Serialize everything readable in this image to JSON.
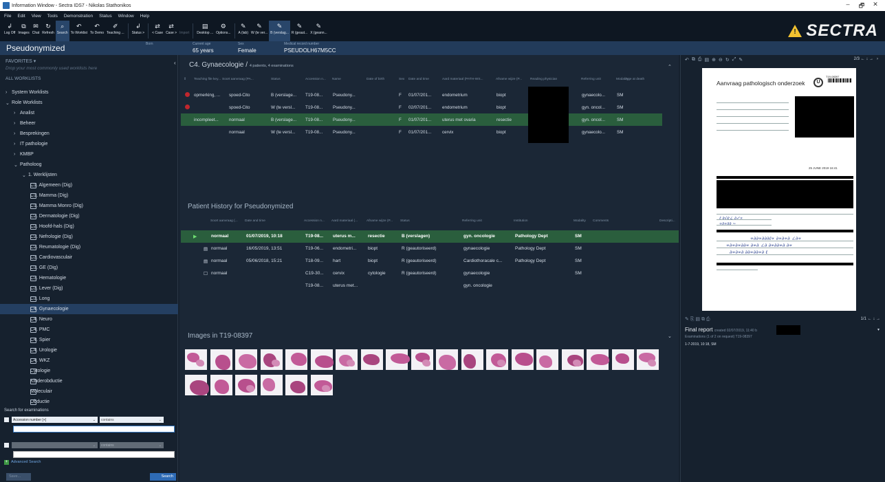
{
  "window": {
    "title": "Information Window - Sectra IDS7 - Nikolas Stathonikos",
    "controls": [
      "–",
      "🗗",
      "✕"
    ]
  },
  "menu": [
    "File",
    "Edit",
    "View",
    "Tools",
    "Demonstration",
    "Status",
    "Window",
    "Help"
  ],
  "toolbar": [
    {
      "label": "Log Off",
      "icon": "↲"
    },
    {
      "label": "Images",
      "icon": "⧉"
    },
    {
      "label": "Chat",
      "icon": "✉"
    },
    {
      "label": "Refresh",
      "icon": "↻"
    },
    {
      "label": "Search",
      "icon": "⌕",
      "active": true
    },
    {
      "label": "To Worklist",
      "icon": "↶"
    },
    {
      "label": "To Demo",
      "icon": "↶"
    },
    {
      "label": "Teaching ...",
      "icon": "✐"
    },
    {
      "label": "Status >",
      "icon": "↲"
    },
    {
      "label": "< Case",
      "icon": "⇄"
    },
    {
      "label": "Case >",
      "icon": "⇄"
    },
    {
      "label": "Import",
      "icon": "",
      "disabled": true
    },
    {
      "label": "Desktop ...",
      "icon": "▤"
    },
    {
      "label": "Options...",
      "icon": "⚙"
    },
    {
      "label": "A (lab)",
      "icon": "✎"
    },
    {
      "label": "W (te ver...",
      "icon": "✎"
    },
    {
      "label": "B (verslag...",
      "icon": "✎",
      "active": true
    },
    {
      "label": "R (geaut...",
      "icon": "✎"
    },
    {
      "label": "X (geann...",
      "icon": "✎"
    }
  ],
  "brand": {
    "name": "SECTRA",
    "warning_color": "#f2c230"
  },
  "patient": {
    "name": "Pseudonymized",
    "fields": [
      {
        "label": "Born",
        "value": ""
      },
      {
        "label": "Current age",
        "value": "65 years"
      },
      {
        "label": "Sex",
        "value": "Female"
      },
      {
        "label": "Medical record number",
        "value": "PSEUDOLH67M5CC"
      }
    ]
  },
  "sidebar": {
    "favorites": "FAVORITES ▾",
    "drop_hint": "Drop your most commonly used worklists here",
    "all_worklists": "ALL WORKLISTS",
    "items": [
      {
        "label": "System Worklists",
        "level": 0,
        "arrow": "›"
      },
      {
        "label": "Role Worklists",
        "level": 0,
        "arrow": "⌄"
      },
      {
        "label": "Analist",
        "level": 1,
        "arrow": "›"
      },
      {
        "label": "Beheer",
        "level": 1,
        "arrow": "›"
      },
      {
        "label": "Besprekingen",
        "level": 1,
        "arrow": "›"
      },
      {
        "label": "IT pathologie",
        "level": 1,
        "arrow": "›"
      },
      {
        "label": "KMBP",
        "level": 1,
        "arrow": "›"
      },
      {
        "label": "Patholoog",
        "level": 1,
        "arrow": "⌄"
      },
      {
        "label": "1. Werklijsten",
        "level": 2,
        "arrow": "⌄"
      },
      {
        "label": "C1. Algemeen (Dig)",
        "level": 3,
        "doc": true
      },
      {
        "label": "C1. Mamma (Dig)",
        "level": 3,
        "doc": true
      },
      {
        "label": "C1. Mamma Monro (Dig)",
        "level": 3,
        "doc": true
      },
      {
        "label": "C2. Dermatologie (Dig)",
        "level": 3,
        "doc": true
      },
      {
        "label": "C2. Hoofd-hals (Dig)",
        "level": 3,
        "doc": true
      },
      {
        "label": "C2. Nefrologie (Dig)",
        "level": 3,
        "doc": true
      },
      {
        "label": "C2. Reumatologie (Dig)",
        "level": 3,
        "doc": true
      },
      {
        "label": "C3. Cardiovasculair",
        "level": 3,
        "doc": true
      },
      {
        "label": "C3. GE (Dig)",
        "level": 3,
        "doc": true
      },
      {
        "label": "C3. Hematologie",
        "level": 3,
        "doc": true
      },
      {
        "label": "C3. Lever (Dig)",
        "level": 3,
        "doc": true
      },
      {
        "label": "C3. Long",
        "level": 3,
        "doc": true
      },
      {
        "label": "C4. Gynaecologie",
        "level": 3,
        "doc": true,
        "selected": true
      },
      {
        "label": "C4. Neuro",
        "level": 3,
        "doc": true
      },
      {
        "label": "C4. PMC",
        "level": 3,
        "doc": true
      },
      {
        "label": "C4. Spier",
        "level": 3,
        "doc": true
      },
      {
        "label": "C4. Urologie",
        "level": 3,
        "doc": true
      },
      {
        "label": "C4. WKZ",
        "level": 3,
        "doc": true
      },
      {
        "label": "Cytologie",
        "level": 3,
        "doc": true
      },
      {
        "label": "Kinderobductie",
        "level": 3,
        "doc": true
      },
      {
        "label": "Moleculair",
        "level": 3,
        "doc": true
      },
      {
        "label": "Obductie",
        "level": 3,
        "doc": true
      }
    ]
  },
  "search": {
    "label": "Search for examinations",
    "field1": "Accession number [+]",
    "op1": "contains",
    "op2": "contains",
    "advanced": "Advanced Search",
    "save": "Save...",
    "go": "Search"
  },
  "worklist": {
    "title": "C4. Gynaecologie /",
    "summary": "4 patients, 4 examinations",
    "headers": [
      "Teaching file key...",
      "Soort aanvraag (PA...",
      "Status",
      "Accession n...",
      "Name",
      "Date of birth",
      "Sex",
      "Date and time",
      "Aard materiaal (PATH-WS...",
      "Afname wijze (P...",
      "Reading physician",
      "Referring unit",
      "Modality",
      "Age at death"
    ],
    "rows": [
      {
        "flag": true,
        "key": "opmerking, ...",
        "soort": "spoed-Cito",
        "status": "B (verslage...",
        "acc": "T19-08...",
        "name": "Pseudony...",
        "sex": "F",
        "dt": "01/07/201...",
        "aard": "endometrium",
        "afname": "biopt",
        "unit": "gynaecolo...",
        "mod": "SM"
      },
      {
        "flag": true,
        "key": "",
        "soort": "spoed-Cito",
        "status": "W (te versl...",
        "acc": "T19-08...",
        "name": "Pseudony...",
        "sex": "F",
        "dt": "02/07/201...",
        "aard": "endometrium",
        "afname": "biopt",
        "unit": "gyn. oncol...",
        "mod": "SM"
      },
      {
        "flag": false,
        "key": "incompleet...",
        "soort": "normaal",
        "status": "B (verslage...",
        "acc": "T19-08...",
        "name": "Pseudony...",
        "sex": "F",
        "dt": "01/07/201...",
        "aard": "uterus met ovaria",
        "afname": "resectie",
        "unit": "gyn. oncol...",
        "mod": "SM",
        "selected": true
      },
      {
        "flag": false,
        "key": "",
        "soort": "normaal",
        "status": "W (te versl...",
        "acc": "T19-08...",
        "name": "Pseudony...",
        "sex": "F",
        "dt": "01/07/201...",
        "aard": "cervix",
        "afname": "biopt",
        "unit": "gynaecolo...",
        "mod": "SM"
      }
    ]
  },
  "history": {
    "title": "Patient History for Pseudonymized",
    "headers": [
      "Soort aanvraag (...",
      "Date and time",
      "Accession n...",
      "Aard materiaal (...",
      "Afname wijze (P...",
      "Status",
      "Referring unit",
      "Institution",
      "Modality",
      "Comments",
      "Descripti..."
    ],
    "rows": [
      {
        "icon": "▶",
        "soort": "normaal",
        "dt": "01/07/2019, 10:18",
        "acc": "T19-08...",
        "aard": "uterus m...",
        "afname": "resectie",
        "status": "B (verslagen)",
        "unit": "gyn. oncologie",
        "inst": "Pathology Dept",
        "mod": "SM",
        "selected": true
      },
      {
        "icon": "▤",
        "soort": "normaal",
        "dt": "16/05/2019, 13:51",
        "acc": "T19-06...",
        "aard": "endometri...",
        "afname": "biopt",
        "status": "R (geautoriseerd)",
        "unit": "gynaecologie",
        "inst": "Pathology Dept",
        "mod": "SM"
      },
      {
        "icon": "▤",
        "soort": "normaal",
        "dt": "05/06/2018, 15:21",
        "acc": "T18-09...",
        "aard": "hart",
        "afname": "biopt",
        "status": "R (geautoriseerd)",
        "unit": "Cardiothoracale c...",
        "inst": "Pathology Dept",
        "mod": "SM"
      },
      {
        "icon": "☐",
        "soort": "normaal",
        "dt": "",
        "acc": "C19-30...",
        "aard": "cervix",
        "afname": "cytologie",
        "status": "R (geautoriseerd)",
        "unit": "gynaecologie",
        "inst": "",
        "mod": "SM"
      },
      {
        "icon": "",
        "soort": "",
        "dt": "",
        "acc": "T19-08...",
        "aard": "uterus met...",
        "afname": "",
        "status": "",
        "unit": "gyn. oncologie",
        "inst": "",
        "mod": ""
      }
    ]
  },
  "images": {
    "title": "Images in T19-08397",
    "count": 25
  },
  "report": {
    "page": "2/3",
    "doc_title": "Aanvraag pathologisch onderzoek",
    "doc_acc": "T19-08397",
    "doc_date": "25 JUNE 2019 16:41",
    "page2": "1/1",
    "final_title": "Final report",
    "final_meta": "created 02/07/2019, 11:40 b",
    "exams": "Examinations (1 of 2 on request) T19-08397",
    "line": "1-7-2019, 10:18, SM"
  }
}
